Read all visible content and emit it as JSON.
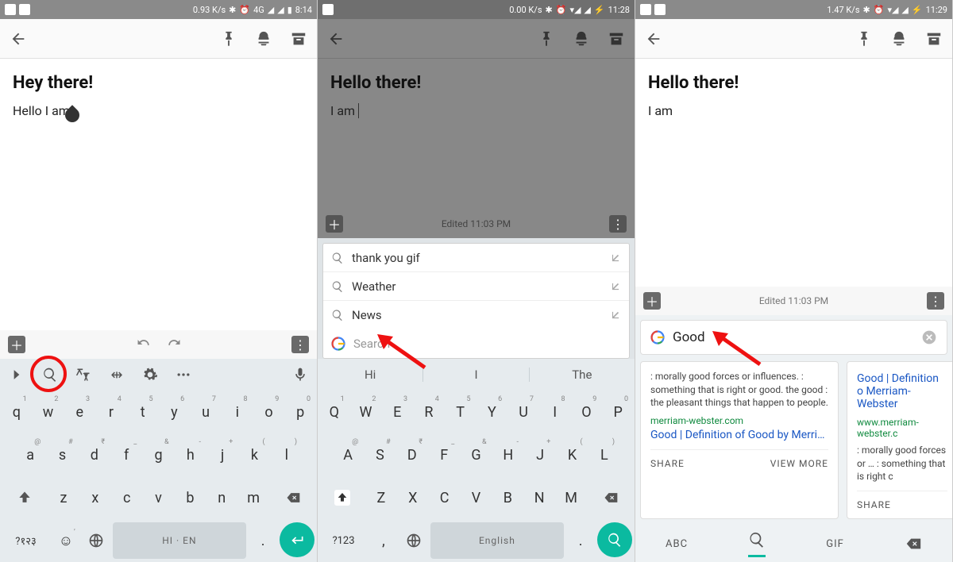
{
  "screens": [
    {
      "status": {
        "net": "0.93 K/s",
        "time": "8:14",
        "hint": "4G"
      },
      "note": {
        "title": "Hey there!",
        "body": "Hello I am"
      },
      "suggest_icons": true,
      "keyboard": {
        "row1": [
          {
            "k": "q",
            "h": "1"
          },
          {
            "k": "w",
            "h": "2"
          },
          {
            "k": "e",
            "h": "3"
          },
          {
            "k": "r",
            "h": "4"
          },
          {
            "k": "t",
            "h": "5"
          },
          {
            "k": "y",
            "h": "6"
          },
          {
            "k": "u",
            "h": "7"
          },
          {
            "k": "i",
            "h": "8"
          },
          {
            "k": "o",
            "h": "9"
          },
          {
            "k": "p",
            "h": "0"
          }
        ],
        "row2": [
          {
            "k": "a",
            "h": "@"
          },
          {
            "k": "s",
            "h": "#"
          },
          {
            "k": "d",
            "h": "₹"
          },
          {
            "k": "f",
            "h": "_"
          },
          {
            "k": "g",
            "h": "&"
          },
          {
            "k": "h",
            "h": "-"
          },
          {
            "k": "j",
            "h": "+"
          },
          {
            "k": "k",
            "h": "("
          },
          {
            "k": "l",
            "h": ")"
          }
        ],
        "row3": [
          "z",
          "x",
          "c",
          "v",
          "b",
          "n",
          "m"
        ],
        "bottom": {
          "sym": "?१२३",
          "space": "HI · EN"
        }
      }
    },
    {
      "status": {
        "net": "0.00 K/s",
        "time": "11:28",
        "hint": ""
      },
      "note": {
        "title": "Hello there!",
        "body": "I am",
        "edited": "Edited 11:03 PM"
      },
      "search_suggestions": [
        "thank you gif",
        "Weather",
        "News"
      ],
      "search_placeholder": "Search",
      "suggest_words": [
        "Hi",
        "I",
        "The"
      ],
      "keyboard": {
        "row1": [
          {
            "k": "Q",
            "h": "1"
          },
          {
            "k": "W",
            "h": "2"
          },
          {
            "k": "E",
            "h": "3"
          },
          {
            "k": "R",
            "h": "4"
          },
          {
            "k": "T",
            "h": "5"
          },
          {
            "k": "Y",
            "h": "6"
          },
          {
            "k": "U",
            "h": "7"
          },
          {
            "k": "I",
            "h": "8"
          },
          {
            "k": "O",
            "h": "9"
          },
          {
            "k": "P",
            "h": "0"
          }
        ],
        "row2": [
          {
            "k": "A",
            "h": "@"
          },
          {
            "k": "S",
            "h": "#"
          },
          {
            "k": "D",
            "h": "₹"
          },
          {
            "k": "F",
            "h": "_"
          },
          {
            "k": "G",
            "h": "&"
          },
          {
            "k": "H",
            "h": "-"
          },
          {
            "k": "J",
            "h": "+"
          },
          {
            "k": "K",
            "h": "("
          },
          {
            "k": "L",
            "h": ")"
          }
        ],
        "row3": [
          "Z",
          "X",
          "C",
          "V",
          "B",
          "N",
          "M"
        ],
        "bottom": {
          "sym": "?123",
          "space": "English"
        }
      }
    },
    {
      "status": {
        "net": "1.47 K/s",
        "time": "11:29",
        "hint": ""
      },
      "note": {
        "title": "Hello there!",
        "body": "I am",
        "edited": "Edited 11:03 PM"
      },
      "gsearch": "Good",
      "cards": [
        {
          "def": ": morally good forces or influences. : something that is right or good. the good : the pleasant things that happen to people.",
          "src": "merriam-webster.com",
          "ttl": "Good | Definition of Good by Merriam-Web…",
          "share": "SHARE",
          "more": "VIEW MORE"
        },
        {
          "def": ": morally good forces or … : something that is right c",
          "src": "www.merriam-webster.c",
          "ttl": "Good | Definition o Merriam-Webster",
          "share": "SHARE"
        }
      ],
      "tabs": {
        "abc": "ABC",
        "gif": "GIF"
      }
    }
  ]
}
